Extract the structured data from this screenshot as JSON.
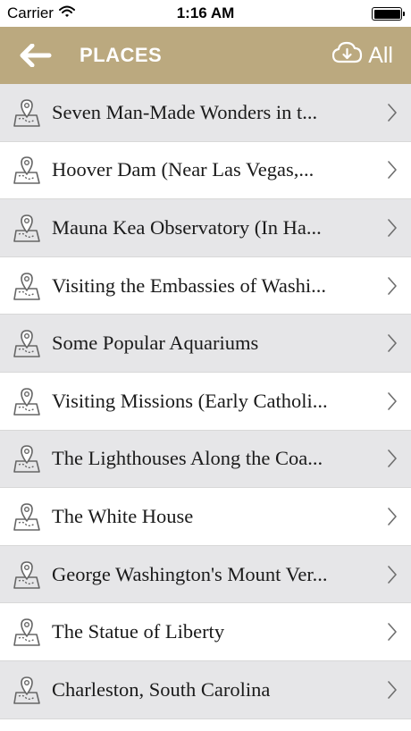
{
  "status_bar": {
    "carrier": "Carrier",
    "time": "1:16 AM"
  },
  "nav": {
    "title": "PLACES",
    "all_label": "All"
  },
  "colors": {
    "nav_background": "#bba97f",
    "row_shaded": "#e6e6e8",
    "row_plain": "#ffffff"
  },
  "places": [
    "Seven Man-Made Wonders in t...",
    "Hoover Dam (Near Las Vegas,...",
    "Mauna Kea Observatory (In Ha...",
    "Visiting the Embassies of Washi...",
    "Some Popular Aquariums",
    "Visiting Missions (Early Catholi...",
    "The Lighthouses Along the Coa...",
    "The White House",
    "George Washington's Mount Ver...",
    "The Statue of Liberty",
    "Charleston, South Carolina"
  ]
}
